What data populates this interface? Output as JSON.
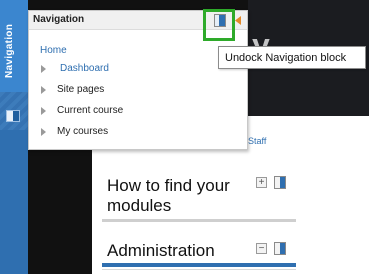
{
  "dock": {
    "tab_label": "Navigation"
  },
  "background": {
    "header_fragment": "y",
    "staff_link": "Staff"
  },
  "navigation_panel": {
    "title": "Navigation",
    "home": "Home",
    "items": [
      {
        "label": "Dashboard"
      },
      {
        "label": "Site pages"
      },
      {
        "label": "Current course"
      },
      {
        "label": "My courses"
      }
    ]
  },
  "tooltip": {
    "text": "Undock Navigation block"
  },
  "blocks": [
    {
      "title": "How to find your modules",
      "control": "+"
    },
    {
      "title": "Administration",
      "control": "−"
    }
  ],
  "colors": {
    "accent": "#2f6fb0",
    "highlight": "#2eaa2a"
  },
  "icons": {
    "undock": "undock-icon",
    "collapse": "collapse-arrow-icon",
    "dock_block": "dock-block-icon"
  }
}
